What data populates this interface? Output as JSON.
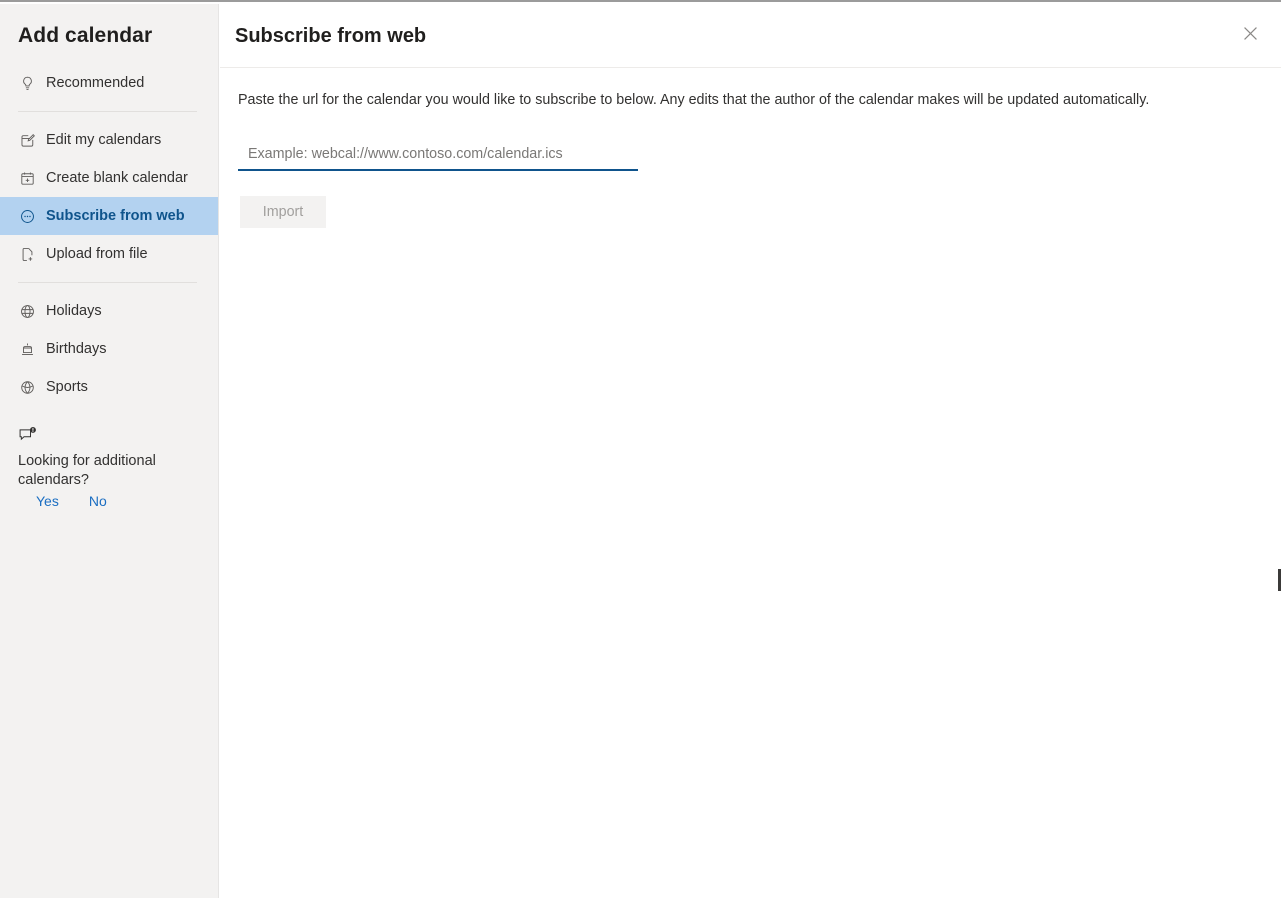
{
  "sidebar": {
    "title": "Add calendar",
    "groups": [
      {
        "items": [
          {
            "label": "Recommended",
            "icon": "lightbulb-icon",
            "selected": false
          }
        ]
      },
      {
        "items": [
          {
            "label": "Edit my calendars",
            "icon": "edit-calendar-icon",
            "selected": false
          },
          {
            "label": "Create blank calendar",
            "icon": "add-calendar-icon",
            "selected": false
          },
          {
            "label": "Subscribe from web",
            "icon": "subscribe-icon",
            "selected": true
          },
          {
            "label": "Upload from file",
            "icon": "upload-file-icon",
            "selected": false
          }
        ]
      },
      {
        "items": [
          {
            "label": "Holidays",
            "icon": "globe-icon",
            "selected": false
          },
          {
            "label": "Birthdays",
            "icon": "cake-icon",
            "selected": false
          },
          {
            "label": "Sports",
            "icon": "sports-ball-icon",
            "selected": false
          }
        ]
      }
    ],
    "feedback": {
      "icon": "feedback-bubble-icon",
      "prompt": "Looking for additional calendars?",
      "yes_label": "Yes",
      "no_label": "No"
    }
  },
  "main": {
    "title": "Subscribe from web",
    "close_icon": "close-icon",
    "description": "Paste the url for the calendar you would like to subscribe to below. Any edits that the author of the calendar makes will be updated automatically.",
    "url_input": {
      "value": "",
      "placeholder": "Example: webcal://www.contoso.com/calendar.ics"
    },
    "import_label": "Import"
  },
  "colors": {
    "accent": "#0f548c",
    "selected_bg": "#b3d2f0",
    "sidebar_bg": "#f3f2f1",
    "link": "#1b6ec2"
  }
}
